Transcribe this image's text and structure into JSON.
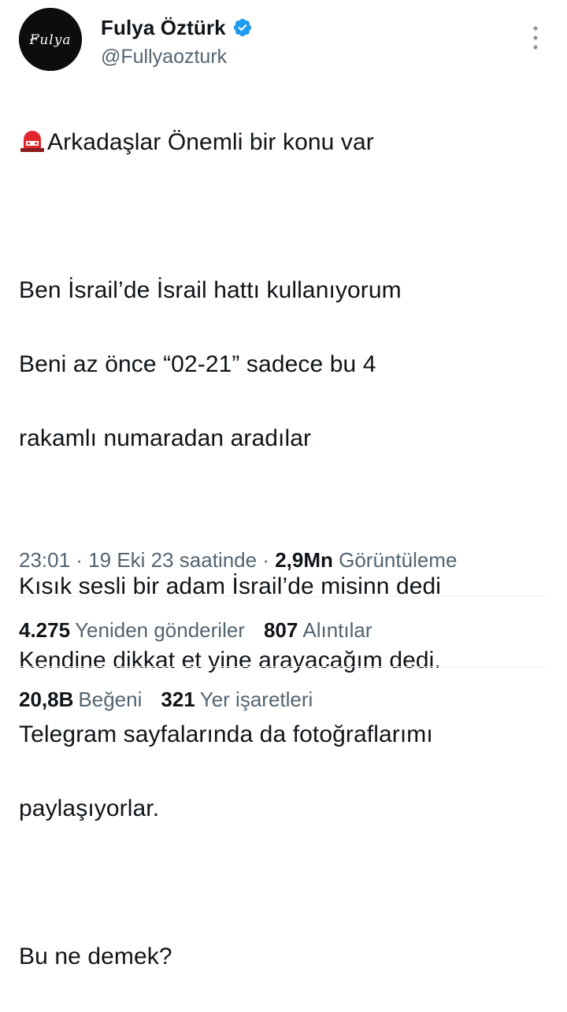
{
  "author": {
    "display_name": "Fulya Öztürk",
    "handle": "@Fullyaozturk",
    "avatar_signature": "Fulya",
    "verified_icon": "verified-badge-icon"
  },
  "menu": {
    "icon": "more-vertical-icon"
  },
  "tweet": {
    "emoji": "rotating-light-icon",
    "lines": [
      "Arkadaşlar Önemli bir konu var",
      "",
      "Ben İsrail’de İsrail hattı kullanıyorum",
      "Beni az önce “02-21” sadece bu 4",
      "rakamlı numaradan aradılar",
      "",
      "Kısık sesli bir adam İsrail’de misinn dedi",
      "Kendine dikkat et yine arayacağım dedi.",
      "Telegram sayfalarında da fotoğraflarımı",
      "paylaşıyorlar.",
      "",
      "Bu ne demek?"
    ]
  },
  "meta": {
    "time_date": "23:01 · 19 Eki 23 saatinde · ",
    "views_count": "2,9Mn",
    "views_label": "Görüntüleme"
  },
  "stats": {
    "retweets_count": "4.275",
    "retweets_label": "Yeniden gönderiler",
    "quotes_count": "807",
    "quotes_label": "Alıntılar",
    "likes_count": "20,8B",
    "likes_label": "Beğeni",
    "bookmarks_count": "321",
    "bookmarks_label": "Yer işaretleri"
  },
  "colors": {
    "text_primary": "#0f1419",
    "text_secondary": "#536471",
    "verified_blue": "#1d9bf0",
    "divider": "#eff3f4",
    "siren_red": "#e0262b"
  }
}
